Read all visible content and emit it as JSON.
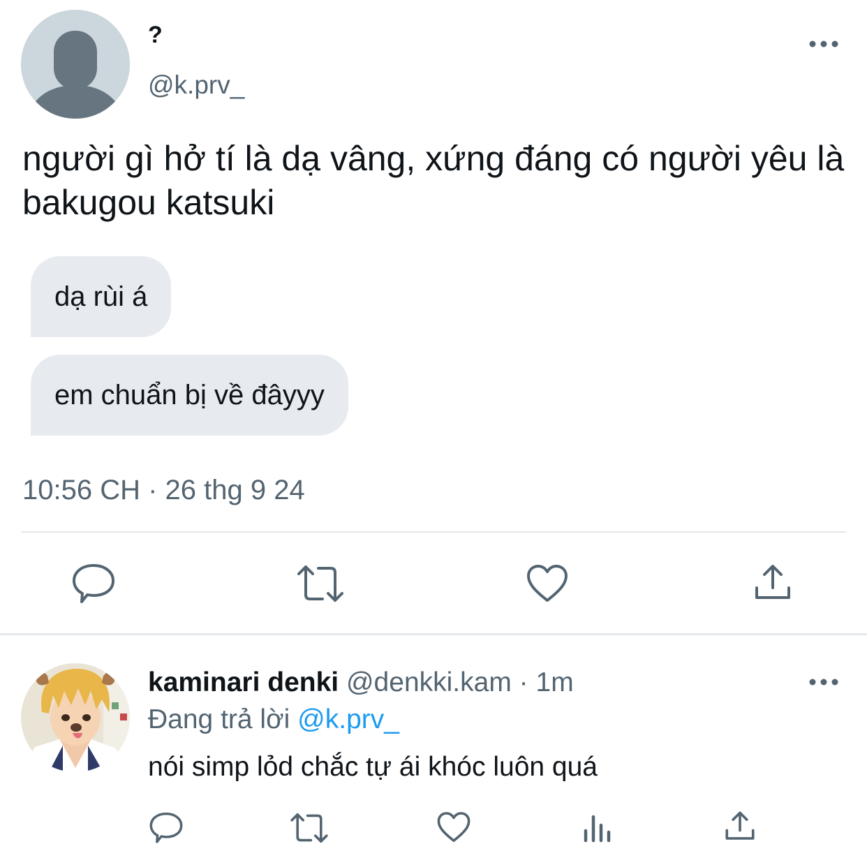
{
  "tweet": {
    "display_name": "?",
    "handle": "@k.prv_",
    "text": "người gì hở tí là dạ vâng, xứng đáng có người yêu là bakugou katsuki",
    "bubbles": [
      "dạ rùi á",
      "em chuẩn bị về đâyyy"
    ],
    "timestamp": "10:56 CH · 26 thg 9 24",
    "icons": {
      "more": "more-icon",
      "reply": "reply-icon",
      "retweet": "retweet-icon",
      "like": "heart-icon",
      "share": "share-icon"
    }
  },
  "reply": {
    "display_name": "kaminari denki",
    "handle": "@denkki.kam",
    "separator": "·",
    "time": "1m",
    "replying_prefix": "Đang trả lời",
    "replying_to": "@k.prv_",
    "text": "nói simp lỏd chắc tự ái khóc luôn quá",
    "icons": {
      "more": "more-icon",
      "reply": "reply-icon",
      "retweet": "retweet-icon",
      "like": "heart-icon",
      "views": "analytics-icon",
      "share": "share-icon"
    }
  },
  "colors": {
    "text_primary": "#0f1419",
    "text_secondary": "#536471",
    "accent": "#1d9bf0",
    "bubble_bg": "#e7ebf0",
    "divider": "#e4e8eb",
    "icon": "#536471"
  }
}
